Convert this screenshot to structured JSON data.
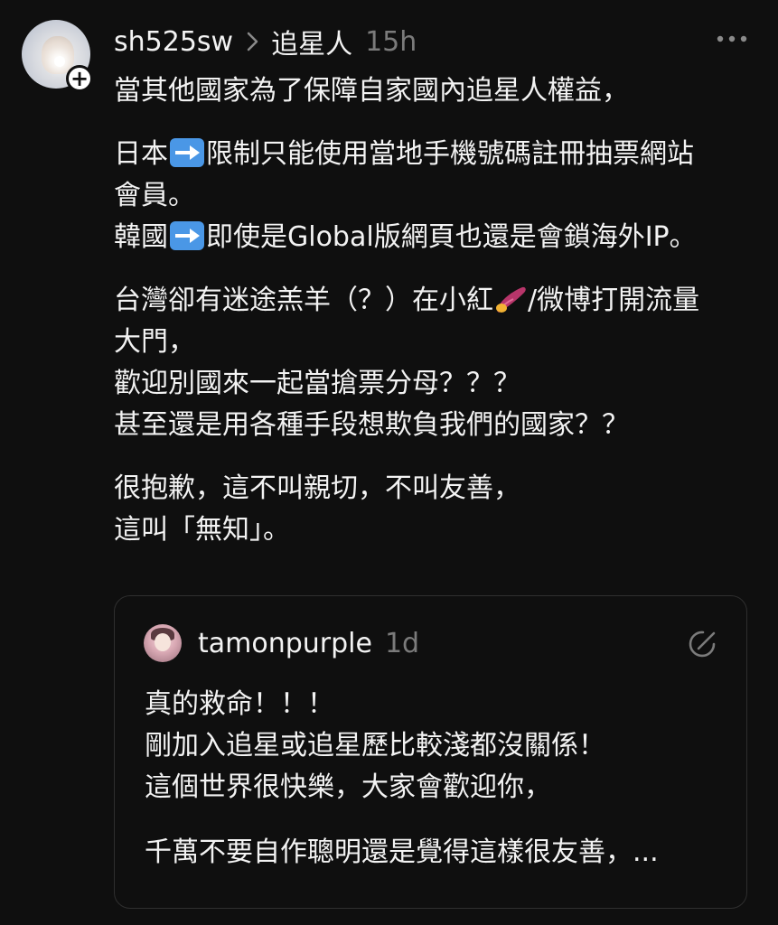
{
  "post": {
    "username": "sh525sw",
    "topic": "追星人",
    "time": "15h",
    "lines": {
      "l1": "當其他國家為了保障自家國內追星人權益，",
      "l2a": "日本",
      "l2b": "限制只能使用當地手機號碼註冊抽票網站",
      "l3": "會員。",
      "l4a": "韓國",
      "l4b": "即使是Global版網頁也還是會鎖海外IP。",
      "l5a": "台灣卻有迷途羔羊（？）在小紅",
      "l5b": "/微博打開流量",
      "l6": "大門，",
      "l7": "歡迎別國來一起當搶票分母？？？",
      "l8": "甚至還是用各種手段想欺負我們的國家？？",
      "l9": "很抱歉，這不叫親切，不叫友善，",
      "l10": "這叫「無知」。"
    },
    "icons": {
      "arrow_emoji": "right-arrow-emoji",
      "pepper_emoji": "sweet-potato-emoji"
    }
  },
  "quoted": {
    "username": "tamonpurple",
    "time": "1d",
    "lines": {
      "l1": "真的救命！！！",
      "l2": "剛加入追星或追星歷比較淺都沒關係！",
      "l3": "這個世界很快樂，大家會歡迎你，",
      "l4": "千萬不要自作聰明還是覺得這樣很友善，..."
    }
  },
  "colors": {
    "background": "#0f0f0f",
    "text": "#f3f3f3",
    "muted": "#7b7b7b",
    "quote_border": "#2f2f2f",
    "arrow_emoji_bg": "#4a97e6"
  }
}
